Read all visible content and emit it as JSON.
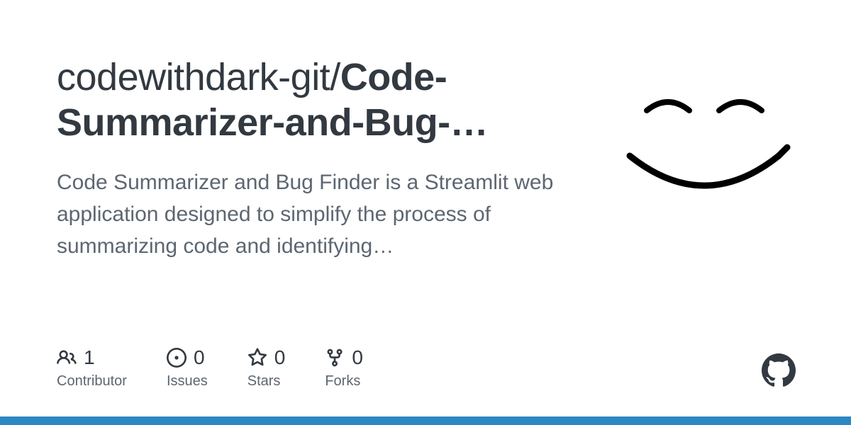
{
  "repo": {
    "owner": "codewithdark-git",
    "separator": "/",
    "name_part1": "Code",
    "name_rest": "-Summarizer-and-Bug-…",
    "description": "Code Summarizer and Bug Finder is a Streamlit web application designed to simplify the process of summarizing code and identifying…"
  },
  "stats": [
    {
      "icon": "people-icon",
      "count": "1",
      "label": "Contributor"
    },
    {
      "icon": "issue-icon",
      "count": "0",
      "label": "Issues"
    },
    {
      "icon": "star-icon",
      "count": "0",
      "label": "Stars"
    },
    {
      "icon": "fork-icon",
      "count": "0",
      "label": "Forks"
    }
  ],
  "colors": {
    "accent_bar": "#2d87c4",
    "text_dark": "#323941",
    "text_muted": "#5d6671"
  }
}
